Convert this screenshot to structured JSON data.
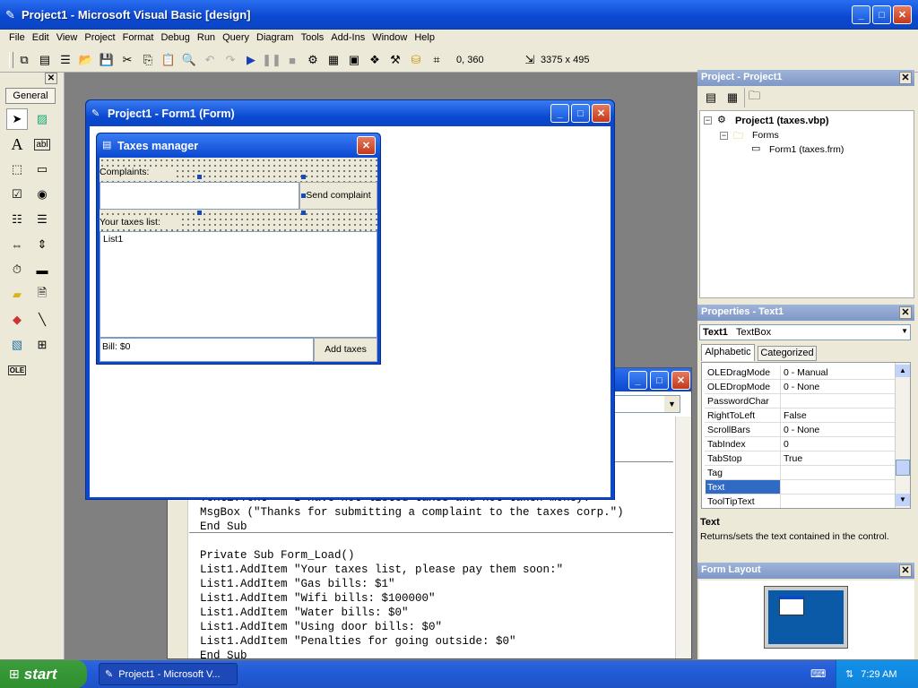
{
  "app": {
    "title": "Project1 - Microsoft Visual Basic [design]"
  },
  "menu": [
    "File",
    "Edit",
    "View",
    "Project",
    "Format",
    "Debug",
    "Run",
    "Query",
    "Diagram",
    "Tools",
    "Add-Ins",
    "Window",
    "Help"
  ],
  "toolbar": {
    "position": "0, 360",
    "size": "3375 x 495"
  },
  "toolbox": {
    "tab_label": "General"
  },
  "form_window": {
    "title": "Project1 - Form1 (Form)"
  },
  "form": {
    "title": "Taxes manager",
    "complaints_label": "Complaints:",
    "send_button": "Send complaint",
    "taxes_label": "Your taxes list:",
    "list_text": "List1",
    "bill_text": "Bill: $0",
    "add_button": "Add taxes"
  },
  "code": {
    "partial_line": "Text1.Text = \"I have not listed taxes and not taken money.\"",
    "lines_top": [
      "MsgBox (\"Thanks for submitting a complaint to the taxes corp.\")",
      "End Sub"
    ],
    "lines_bottom": [
      "Private Sub Form_Load()",
      "List1.AddItem \"Your taxes list, please pay them soon:\"",
      "List1.AddItem \"Gas bills: $1\"",
      "List1.AddItem \"Wifi bills: $100000\"",
      "List1.AddItem \"Water bills: $0\"",
      "List1.AddItem \"Using door bills: $0\"",
      "List1.AddItem \"Penalties for going outside: $0\"",
      "End Sub"
    ]
  },
  "project": {
    "title": "Project - Project1",
    "root": "Project1 (taxes.vbp)",
    "folder": "Forms",
    "form_item": "Form1 (taxes.frm)"
  },
  "properties": {
    "title": "Properties - Text1",
    "object_name": "Text1",
    "object_type": "TextBox",
    "tab_alpha": "Alphabetic",
    "tab_cat": "Categorized",
    "rows": [
      {
        "name": "OLEDragMode",
        "value": "0 - Manual"
      },
      {
        "name": "OLEDropMode",
        "value": "0 - None"
      },
      {
        "name": "PasswordChar",
        "value": ""
      },
      {
        "name": "RightToLeft",
        "value": "False"
      },
      {
        "name": "ScrollBars",
        "value": "0 - None"
      },
      {
        "name": "TabIndex",
        "value": "0"
      },
      {
        "name": "TabStop",
        "value": "True"
      },
      {
        "name": "Tag",
        "value": ""
      },
      {
        "name": "Text",
        "value": ""
      },
      {
        "name": "ToolTipText",
        "value": ""
      }
    ],
    "desc_title": "Text",
    "desc_text": "Returns/sets the text contained in the control."
  },
  "form_layout": {
    "title": "Form Layout"
  },
  "taskbar": {
    "start": "start",
    "task": "Project1 - Microsoft V...",
    "time": "7:29 AM"
  }
}
